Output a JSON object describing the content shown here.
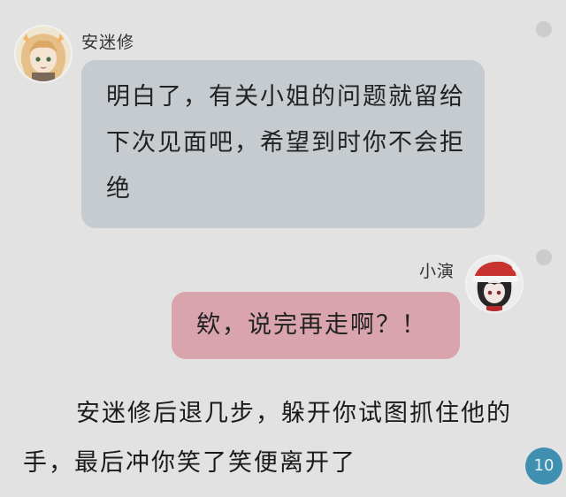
{
  "messages": [
    {
      "sender": "安迷修",
      "avatar_icon": "anime-girl-avatar-icon",
      "side": "left",
      "text": "明白了，有关小姐的问题就留给下次见面吧，希望到时你不会拒绝",
      "bubble_color": "#c6cbd0"
    },
    {
      "sender": "小演",
      "avatar_icon": "anime-santa-hat-avatar-icon",
      "side": "right",
      "text": "欸，说完再走啊？！",
      "bubble_color": "#d9a4ae"
    }
  ],
  "narration": "安迷修后退几步，躲开你试图抓住他的手，最后冲你笑了笑便离开了",
  "page_badge": "10",
  "colors": {
    "background": "#e2e2e2",
    "badge": "#3f8fb1"
  }
}
